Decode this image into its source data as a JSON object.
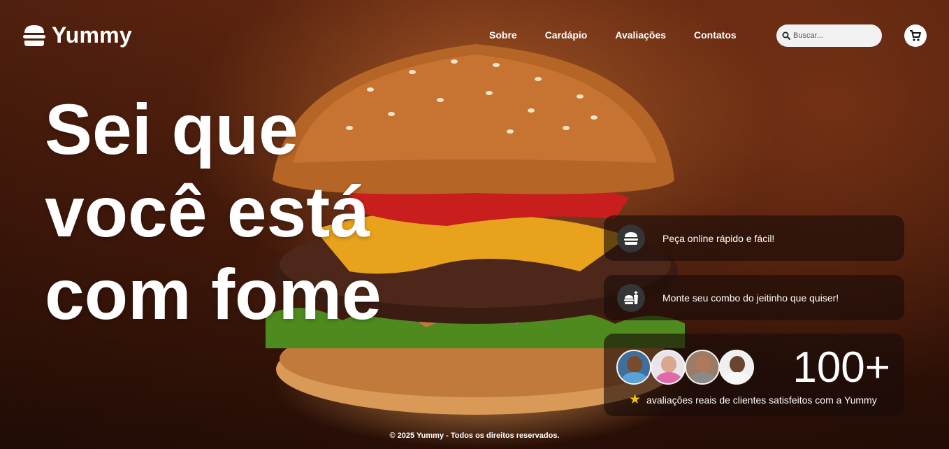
{
  "brand": {
    "name": "Yummy",
    "logo_icon": "burger-icon"
  },
  "nav": {
    "items": [
      {
        "label": "Sobre"
      },
      {
        "label": "Cardápio"
      },
      {
        "label": "Avaliações"
      },
      {
        "label": "Contatos"
      }
    ]
  },
  "search": {
    "placeholder": "Buscar...",
    "icon": "search-icon"
  },
  "cart": {
    "icon": "cart-icon"
  },
  "hero": {
    "headline_lines": [
      "Sei que",
      "você está",
      "com fome"
    ]
  },
  "features": [
    {
      "icon": "burger-icon",
      "text": "Peça online rápido e fácil!"
    },
    {
      "icon": "combo-meal-icon",
      "text": "Monte seu combo do jeitinho que quiser!"
    }
  ],
  "reviews": {
    "count": "100+",
    "text": "avaliações reais de clientes satisfeitos com a Yummy",
    "star_icon": "star-icon"
  },
  "footer": {
    "text": "© 2025 Yummy - Todos os direitos reservados."
  },
  "colors": {
    "star": "#f5c400",
    "card_bg": "#190c08",
    "icon_circle": "#353535"
  }
}
